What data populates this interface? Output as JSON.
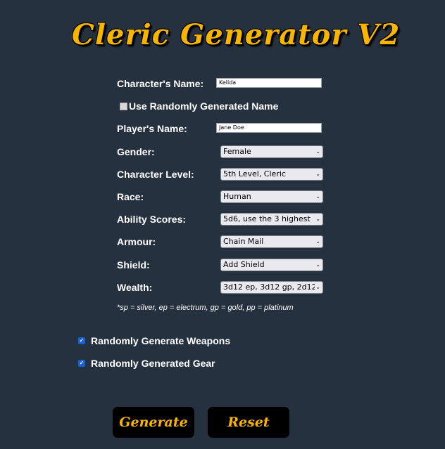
{
  "header": {
    "title": "Cleric Generator V2"
  },
  "form": {
    "character_name": {
      "label": "Character's Name:",
      "value": "Kelida"
    },
    "random_name": {
      "label": "Use Randomly Generated Name",
      "checked": false
    },
    "player_name": {
      "label": "Player's Name:",
      "value": "Jane Doe"
    },
    "gender": {
      "label": "Gender:",
      "selected": "Female"
    },
    "character_level": {
      "label": "Character Level:",
      "selected": "5th Level, Cleric"
    },
    "race": {
      "label": "Race:",
      "selected": "Human"
    },
    "ability_scores": {
      "label": "Ability Scores:",
      "selected": "5d6, use the 3 highest"
    },
    "armour": {
      "label": "Armour:",
      "selected": "Chain Mail"
    },
    "shield": {
      "label": "Shield:",
      "selected": "Add Shield"
    },
    "wealth": {
      "label": "Wealth:",
      "selected": "3d12 ep, 3d12 gp, 2d12"
    },
    "note": "*sp = silver, ep = electrum, gp = gold, pp = platinum",
    "random_weapons": {
      "label": "Randomly Generate Weapons",
      "checked": true
    },
    "random_gear": {
      "label": "Randomly Generated Gear",
      "checked": true
    }
  },
  "buttons": {
    "generate": "Generate",
    "reset": "Reset"
  },
  "icons": {
    "chevron": "⌄",
    "check": "✓"
  },
  "colors": {
    "background": "#263140",
    "accent_gold": "#f7b500",
    "button_bg": "#000000",
    "checkbox_blue": "#1a5fd0"
  }
}
